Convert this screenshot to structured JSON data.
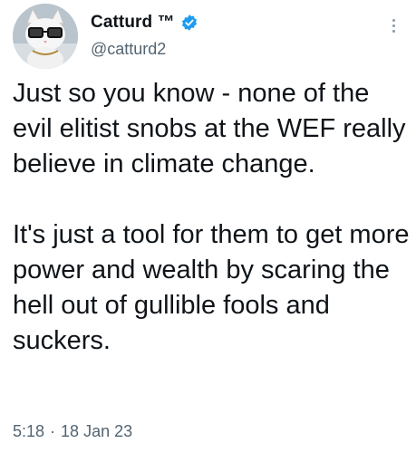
{
  "author": {
    "display_name": "Catturd ™",
    "handle": "@catturd2",
    "avatar_icon": "cat-with-glasses-avatar",
    "verified": true,
    "verified_color": "#1d9bf0"
  },
  "tweet": {
    "text": "Just so you know - none of the evil elitist snobs at the WEF really believe in climate change.\n\nIt's just a tool for them to get more power and wealth by scaring the hell out of gullible fools and suckers.",
    "time": "5:18",
    "separator": "·",
    "date": "18 Jan 23"
  },
  "menu": {
    "icon": "more-vertical-icon"
  }
}
